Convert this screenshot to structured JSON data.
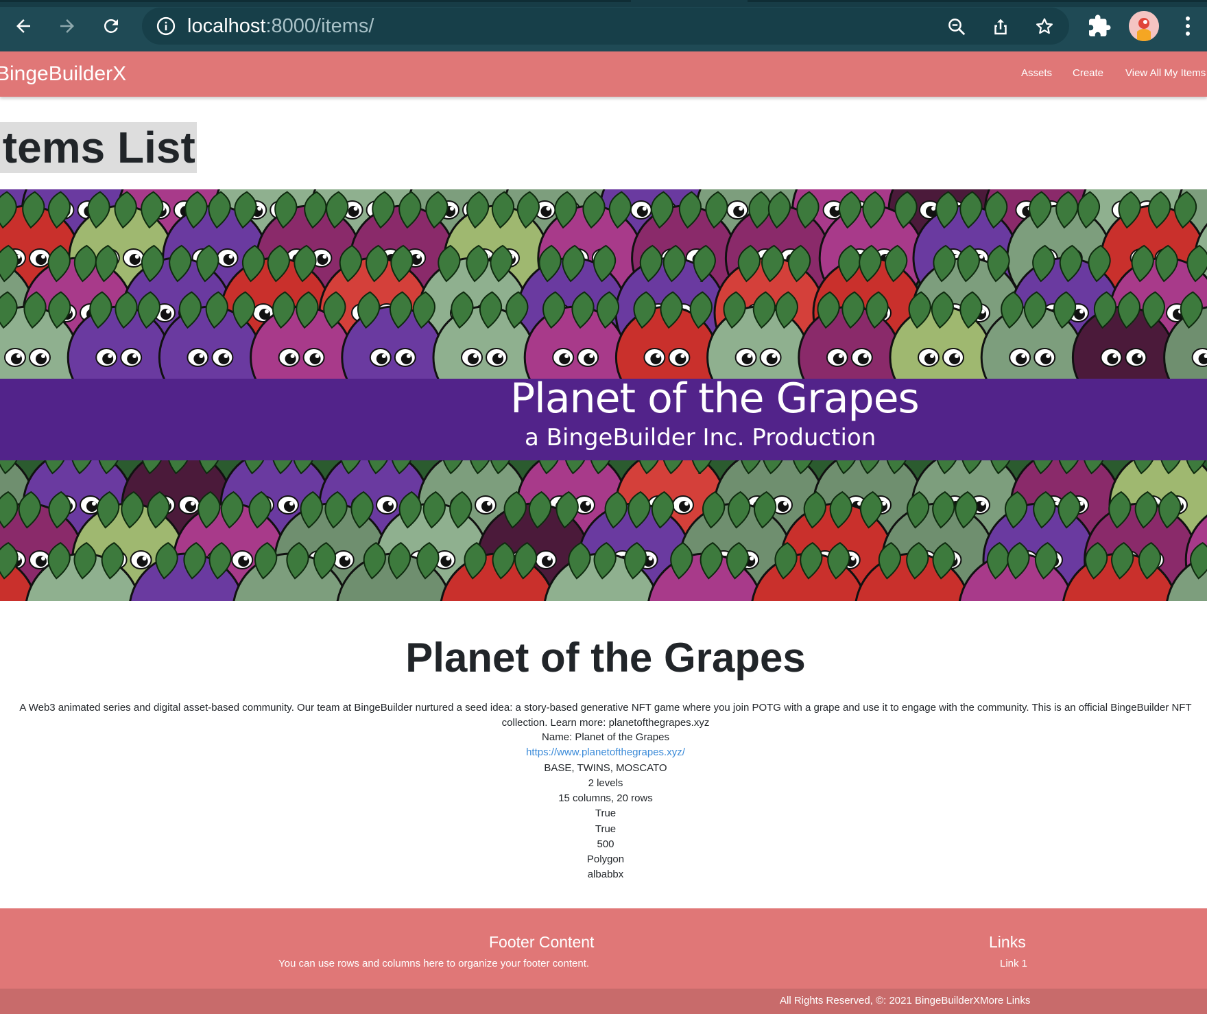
{
  "browser": {
    "url_host": "localhost",
    "url_rest": ":8000/items/"
  },
  "navbar": {
    "brand": "BingeBuilderX",
    "links": [
      "Assets",
      "Create",
      "View All My Items"
    ]
  },
  "page": {
    "heading": "Items List"
  },
  "banner": {
    "title": "Planet of the Grapes",
    "subtitle": "a BingeBuilder Inc. Production"
  },
  "item": {
    "title": "Planet of the Grapes",
    "description": "A Web3 animated series and digital asset-based community. Our team at BingeBuilder nurtured a seed idea: a story-based generative NFT game where you join POTG with a grape and use it to engage with the community. This is an official BingeBuilder NFT collection. Learn more: planetofthegrapes.xyz",
    "name_line": "Name: Planet of the Grapes",
    "link": "https://www.planetofthegrapes.xyz/",
    "traits": "BASE, TWINS, MOSCATO",
    "levels": "2 levels",
    "grid": "15 columns, 20 rows",
    "flag1": "True",
    "flag2": "True",
    "supply": "500",
    "chain": "Polygon",
    "owner": "albabbx"
  },
  "footer": {
    "content_heading": "Footer Content",
    "content_text": "You can use rows and columns here to organize your footer content.",
    "links_heading": "Links",
    "link1": "Link 1",
    "copyright": "All Rights Reserved, ©: 2021 BingeBuilderXMore Links"
  },
  "colors": {
    "chrome": "#1f4a55",
    "navbar": "#e07777",
    "banner_band": "#52238a",
    "link": "#3a8ad8"
  },
  "icons": [
    "back-arrow-icon",
    "forward-arrow-icon",
    "reload-icon",
    "info-icon",
    "zoom-icon",
    "share-icon",
    "bookmark-star-icon",
    "extensions-puzzle-icon",
    "profile-avatar-icon",
    "kebab-menu-icon"
  ]
}
